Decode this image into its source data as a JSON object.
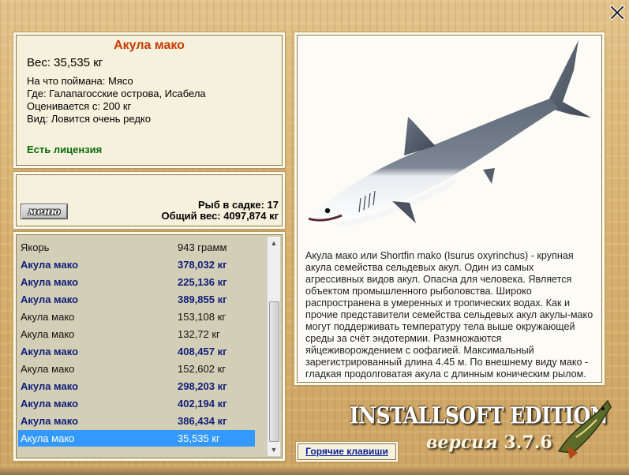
{
  "info": {
    "fish_name": "Акула мако",
    "weight": "Вес: 35,535 кг",
    "bait": "На что поймана: Мясо",
    "location": "Где: Галапагосские острова, Исабела",
    "price": "Оценивается с: 200 кг",
    "rarity": "Вид: Ловится очень редко",
    "license": "Есть лицензия"
  },
  "stats": {
    "menu_label": "меню",
    "fish_count": "Рыб в садке: 17",
    "total_weight": "Общий вес: 4097,874 кг"
  },
  "catch_list": [
    {
      "name": "Якорь",
      "weight": "943 грамм",
      "style": "normal"
    },
    {
      "name": "Акула мако",
      "weight": "378,032 кг",
      "style": "bold"
    },
    {
      "name": "Акула мако",
      "weight": "225,136 кг",
      "style": "bold"
    },
    {
      "name": "Акула мако",
      "weight": "389,855 кг",
      "style": "bold"
    },
    {
      "name": "Акула мако",
      "weight": "153,108 кг",
      "style": "normal"
    },
    {
      "name": "Акула мако",
      "weight": "132,72 кг",
      "style": "normal"
    },
    {
      "name": "Акула мако",
      "weight": "408,457 кг",
      "style": "bold"
    },
    {
      "name": "Акула мако",
      "weight": "152,602 кг",
      "style": "normal"
    },
    {
      "name": "Акула мако",
      "weight": "298,203 кг",
      "style": "bold"
    },
    {
      "name": "Акула мако",
      "weight": "402,194 кг",
      "style": "bold"
    },
    {
      "name": "Акула мако",
      "weight": "386,434 кг",
      "style": "bold"
    },
    {
      "name": "Акула мако",
      "weight": "35,535 кг",
      "style": "selected"
    }
  ],
  "description": "Акула мако или Shortfin mako (Isurus oxyrinchus) - крупная акула семейства сельдевых акул. Один из самых агрессивных видов акул. Опасна для человека. Является объектом промышленного рыболовства. Широко распространена в умеренных и тропических водах. Как и прочие представители семейства сельдевых акул акулы-мако могут поддерживать температуру тела выше окружающей среды за счёт эндотермии. Размножаются яйцеживорождением с оофагией. Максимальный зарегистрированный длина 4.45 м. По внешнему виду мако - гладкая продолговатая акула с длинным коническим рылом.",
  "branding": {
    "edition": "INSTALLSOFT EDITION",
    "version_word": "версия",
    "version_number": "3.7.6"
  },
  "hotkeys_label": "Горячие клавиши",
  "icons": {
    "close": "close-icon",
    "fish_image": "mako-shark-image",
    "logo": "pike-logo"
  },
  "colors": {
    "title": "#c63a05",
    "license": "#0a6a0a",
    "bold_row": "#0f1d7a",
    "selected_row": "#3399ff",
    "link": "#0a1f9a"
  }
}
